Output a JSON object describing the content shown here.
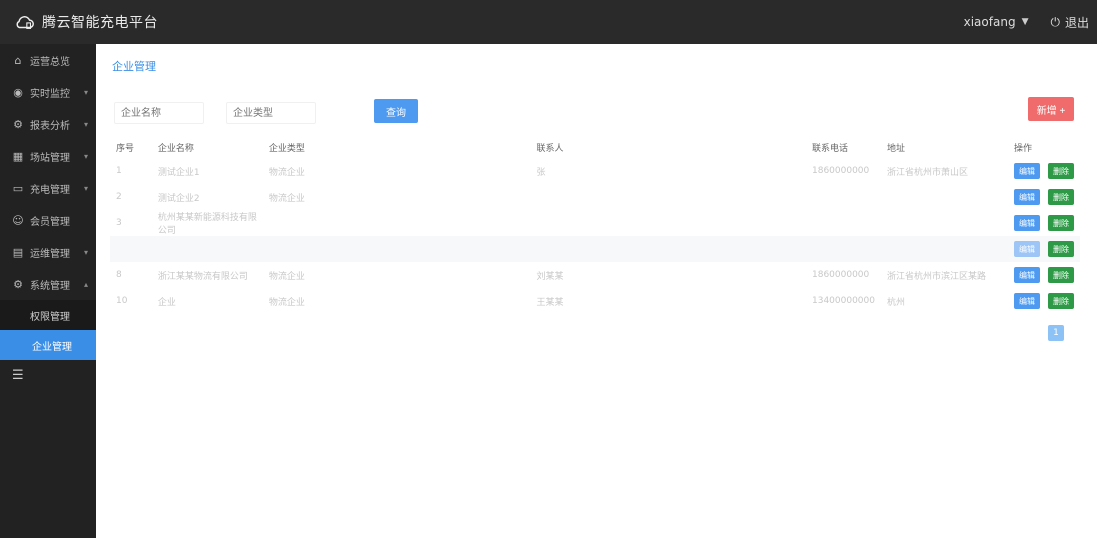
{
  "app": {
    "title": "腾云智能充电平台"
  },
  "header": {
    "username": "xiaofang",
    "logout_label": "退出"
  },
  "sidebar": {
    "items": [
      {
        "label": "运营总览",
        "icon": "home-icon",
        "glyph": "⌂"
      },
      {
        "label": "实时监控",
        "icon": "location-icon",
        "glyph": "◉"
      },
      {
        "label": "报表分析",
        "icon": "settings-icon",
        "glyph": "⚙"
      },
      {
        "label": "场站管理",
        "icon": "station-icon",
        "glyph": "▦"
      },
      {
        "label": "充电管理",
        "icon": "charge-icon",
        "glyph": "▭"
      },
      {
        "label": "会员管理",
        "icon": "user-icon",
        "glyph": "☺"
      },
      {
        "label": "运维管理",
        "icon": "tools-icon",
        "glyph": "▤"
      },
      {
        "label": "系统管理",
        "icon": "gear-icon",
        "glyph": "⚙"
      }
    ],
    "sub_items": [
      {
        "label": "权限管理",
        "active": false
      },
      {
        "label": "企业管理",
        "active": true
      }
    ]
  },
  "main": {
    "breadcrumb": "企业管理",
    "filter1_placeholder": "企业名称",
    "filter2_placeholder": "企业类型",
    "query_label": "查询",
    "add_label": "新增 +",
    "columns": [
      "序号",
      "企业名称",
      "企业类型",
      "联系人",
      "联系电话",
      "地址",
      "操作"
    ],
    "rows": [
      {
        "no": "1",
        "name": "测试企业1",
        "type": "物流企业",
        "contact": "张",
        "phone": "1860000000",
        "address": "浙江省杭州市萧山区",
        "edit": "编辑",
        "del": "删除"
      },
      {
        "no": "2",
        "name": "测试企业2",
        "type": "物流企业",
        "contact": "",
        "phone": "",
        "address": "",
        "edit": "编辑",
        "del": "删除"
      },
      {
        "no": "3",
        "name": "杭州某某新能源科技有限公司",
        "type": "",
        "contact": "",
        "phone": "",
        "address": "",
        "edit": "编辑",
        "del": "删除"
      },
      {
        "no": "",
        "name": "",
        "type": "",
        "contact": "",
        "phone": "",
        "address": "",
        "edit": "编辑",
        "del": "删除"
      },
      {
        "no": "8",
        "name": "浙江某某物流有限公司",
        "type": "物流企业",
        "contact": "刘某某",
        "phone": "1860000000",
        "address": "浙江省杭州市滨江区某路",
        "edit": "编辑",
        "del": "删除"
      },
      {
        "no": "10",
        "name": "企业",
        "type": "物流企业",
        "contact": "王某某",
        "phone": "13400000000",
        "address": "杭州",
        "edit": "编辑",
        "del": "删除"
      }
    ],
    "page": "1"
  }
}
